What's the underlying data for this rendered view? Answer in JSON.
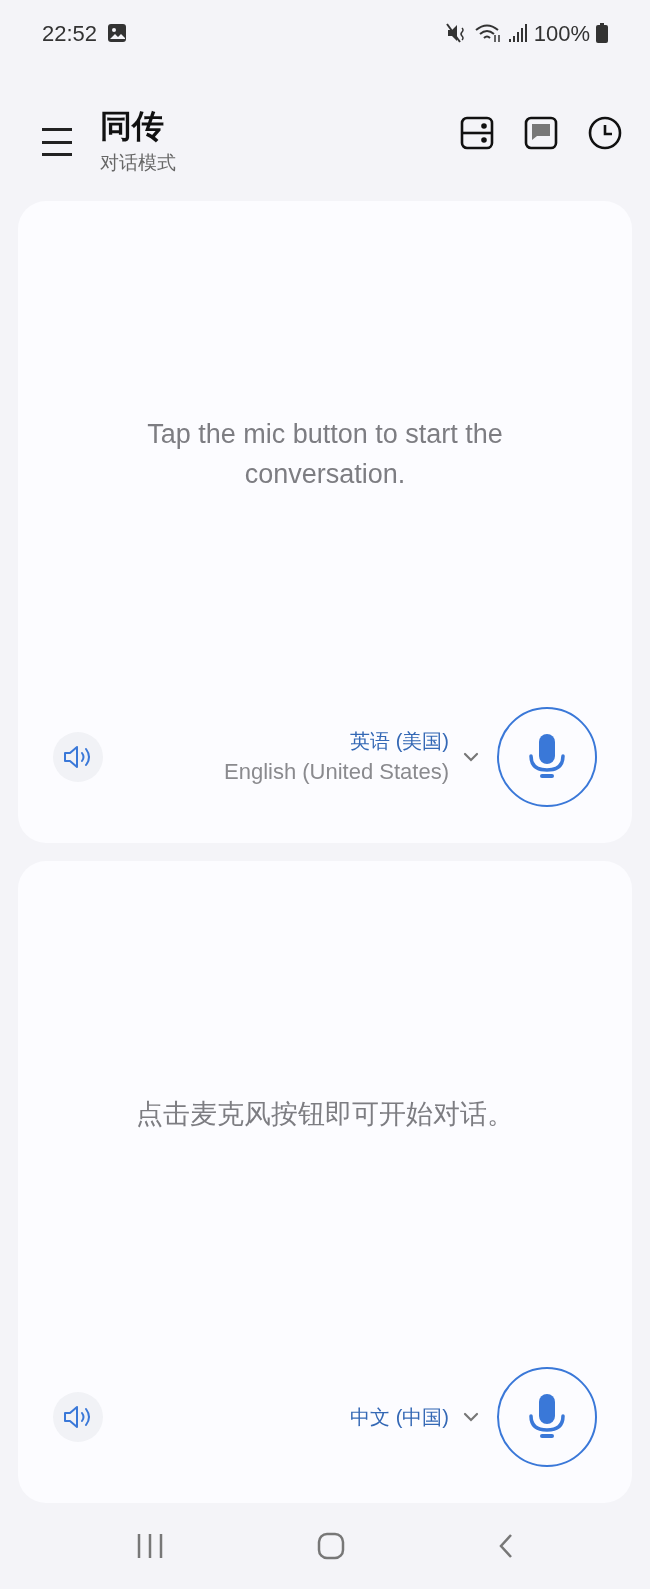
{
  "status_bar": {
    "time": "22:52",
    "battery": "100%"
  },
  "header": {
    "title": "同传",
    "subtitle": "对话模式"
  },
  "panels": [
    {
      "prompt": "Tap the mic button to start the conversation.",
      "language": "英语 (美国)",
      "language_native": "English (United States)"
    },
    {
      "prompt": "点击麦克风按钮即可开始对话。",
      "language": "中文 (中国)"
    }
  ]
}
